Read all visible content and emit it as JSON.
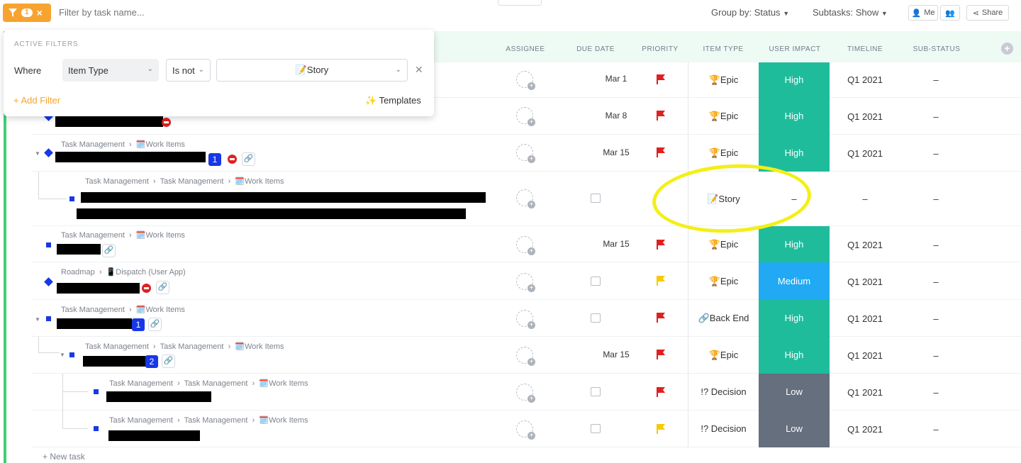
{
  "toolbar": {
    "filter_count": "1",
    "filter_placeholder": "Filter by task name...",
    "group_by": "Group by: Status",
    "subtasks": "Subtasks: Show",
    "me_label": "Me",
    "share_label": "Share"
  },
  "columns": {
    "assignee": "ASSIGNEE",
    "due_date": "DUE DATE",
    "priority": "PRIORITY",
    "item_type": "ITEM TYPE",
    "user_impact": "USER IMPACT",
    "timeline": "TIMELINE",
    "sub_status": "SUB-STATUS"
  },
  "filter_panel": {
    "title": "ACTIVE FILTERS",
    "where": "Where",
    "field": "Item Type",
    "operator": "Is not",
    "value": "📝Story",
    "add_filter": "+ Add Filter",
    "templates": "Templates"
  },
  "crumbs": {
    "tm": "Task Management",
    "wi": "🗓️Work Items",
    "roadmap": "Roadmap",
    "dispatch": "📱Dispatch (User App)"
  },
  "rows": [
    {
      "due": "Mar 1",
      "flag": "#e02020",
      "type": "🏆Epic",
      "impact": "High",
      "impact_color": "#1fbc9c",
      "timeline": "Q1 2021",
      "sub": "–"
    },
    {
      "due": "Mar 8",
      "flag": "#e02020",
      "type": "🏆Epic",
      "impact": "High",
      "impact_color": "#1fbc9c",
      "timeline": "Q1 2021",
      "sub": "–"
    },
    {
      "due": "Mar 15",
      "flag": "#e02020",
      "type": "🏆Epic",
      "impact": "High",
      "impact_color": "#1fbc9c",
      "timeline": "Q1 2021",
      "sub": "–",
      "count": "1"
    },
    {
      "due": "",
      "flag": "",
      "type": "📝Story",
      "impact": "–",
      "impact_color": "",
      "timeline": "–",
      "sub": "–"
    },
    {
      "due": "Mar 15",
      "flag": "#e02020",
      "type": "🏆Epic",
      "impact": "High",
      "impact_color": "#1fbc9c",
      "timeline": "Q1 2021",
      "sub": "–"
    },
    {
      "due": "",
      "flag": "#f8ca00",
      "type": "🏆Epic",
      "impact": "Medium",
      "impact_color": "#22a9f3",
      "timeline": "Q1 2021",
      "sub": "–"
    },
    {
      "due": "",
      "flag": "#e02020",
      "type": "🔗Back End",
      "impact": "High",
      "impact_color": "#1fbc9c",
      "timeline": "Q1 2021",
      "sub": "–",
      "count": "1"
    },
    {
      "due": "Mar 15",
      "flag": "#e02020",
      "type": "🏆Epic",
      "impact": "High",
      "impact_color": "#1fbc9c",
      "timeline": "Q1 2021",
      "sub": "–",
      "count": "2"
    },
    {
      "due": "",
      "flag": "#e02020",
      "type": "!? Decision",
      "impact": "Low",
      "impact_color": "#656f7d",
      "timeline": "Q1 2021",
      "sub": "–"
    },
    {
      "due": "",
      "flag": "#f8ca00",
      "type": "!? Decision",
      "impact": "Low",
      "impact_color": "#656f7d",
      "timeline": "Q1 2021",
      "sub": "–"
    }
  ],
  "new_task": "+ New task"
}
